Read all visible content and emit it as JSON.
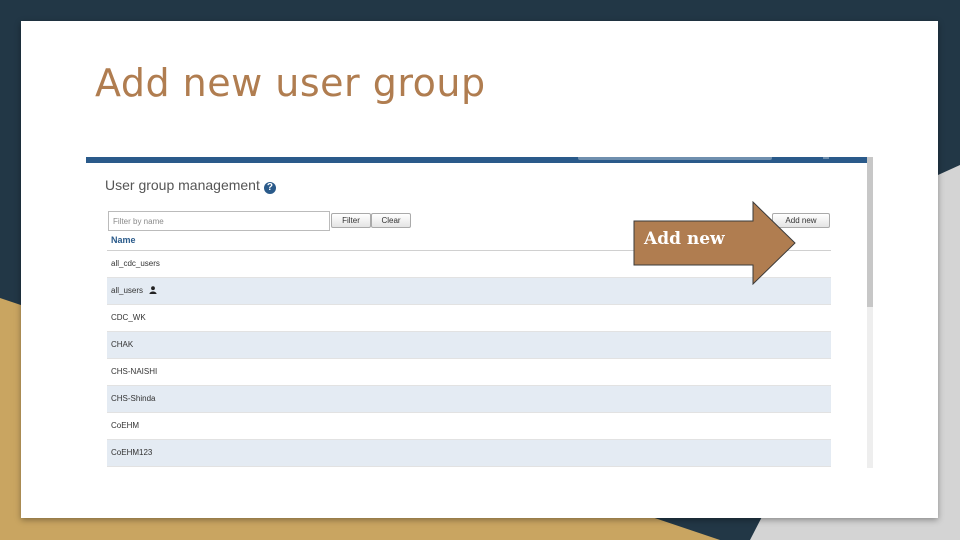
{
  "slide": {
    "title": "Add new user group"
  },
  "colors": {
    "background_dark": "#223746",
    "background_gold": "#c9a561",
    "title": "#b07d50",
    "arrow": "#b07d50",
    "brand_blue": "#2a5a8a",
    "row_alt": "#e4ebf3"
  },
  "panel": {
    "heading": "User group management",
    "help_icon": "question-circle-icon"
  },
  "filter": {
    "placeholder": "Filter by name",
    "filter_label": "Filter",
    "clear_label": "Clear"
  },
  "add_button": {
    "label": "Add new"
  },
  "table": {
    "header": "Name",
    "rows": [
      {
        "name": "all_cdc_users"
      },
      {
        "name": "all_users",
        "icon": "user-icon"
      },
      {
        "name": "CDC_WK"
      },
      {
        "name": "CHAK"
      },
      {
        "name": "CHS-NAISHI"
      },
      {
        "name": "CHS-Shinda"
      },
      {
        "name": "CoEHM"
      },
      {
        "name": "CoEHM123"
      }
    ]
  },
  "annotation": {
    "label": "Add new"
  }
}
